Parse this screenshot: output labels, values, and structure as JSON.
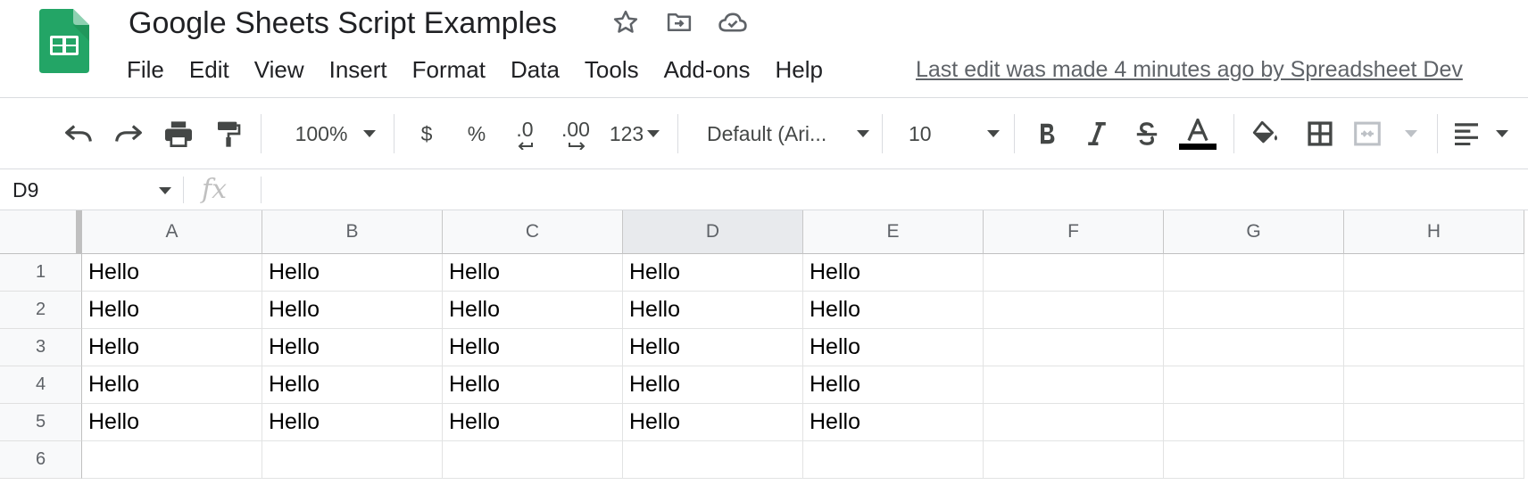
{
  "document": {
    "title": "Google Sheets Script Examples",
    "last_edit": "Last edit was made 4 minutes ago by Spreadsheet Dev"
  },
  "title_icons": [
    "star-icon",
    "move-to-folder-icon",
    "cloud-saved-icon"
  ],
  "menu": [
    "File",
    "Edit",
    "View",
    "Insert",
    "Format",
    "Data",
    "Tools",
    "Add-ons",
    "Help"
  ],
  "toolbar": {
    "zoom": "100%",
    "currency": "$",
    "percent": "%",
    "decrease_decimal": ".0",
    "increase_decimal": ".00",
    "more_formats": "123",
    "font": "Default (Ari...",
    "font_size": "10",
    "text_color": "#000000",
    "icons": [
      "undo-icon",
      "redo-icon",
      "print-icon",
      "paint-format-icon",
      "bold-icon",
      "italic-icon",
      "strikethrough-icon",
      "text-color-icon",
      "fill-color-icon",
      "borders-icon",
      "merge-cells-icon",
      "horizontal-align-icon"
    ]
  },
  "formula_bar": {
    "cell_ref": "D9",
    "fx": "fx",
    "value": ""
  },
  "sheet": {
    "columns": [
      "A",
      "B",
      "C",
      "D",
      "E",
      "F",
      "G",
      "H"
    ],
    "active_column": "D",
    "rows": [
      "1",
      "2",
      "3",
      "4",
      "5",
      "6"
    ],
    "cells": [
      [
        "Hello",
        "Hello",
        "Hello",
        "Hello",
        "Hello",
        "",
        "",
        ""
      ],
      [
        "Hello",
        "Hello",
        "Hello",
        "Hello",
        "Hello",
        "",
        "",
        ""
      ],
      [
        "Hello",
        "Hello",
        "Hello",
        "Hello",
        "Hello",
        "",
        "",
        ""
      ],
      [
        "Hello",
        "Hello",
        "Hello",
        "Hello",
        "Hello",
        "",
        "",
        ""
      ],
      [
        "Hello",
        "Hello",
        "Hello",
        "Hello",
        "Hello",
        "",
        "",
        ""
      ],
      [
        "",
        "",
        "",
        "",
        "",
        "",
        "",
        ""
      ]
    ]
  },
  "colors": {
    "logo_green": "#23A566",
    "header_bg": "#f8f9fa",
    "active_header_bg": "#e8eaed",
    "gridline": "#e2e3e3"
  }
}
